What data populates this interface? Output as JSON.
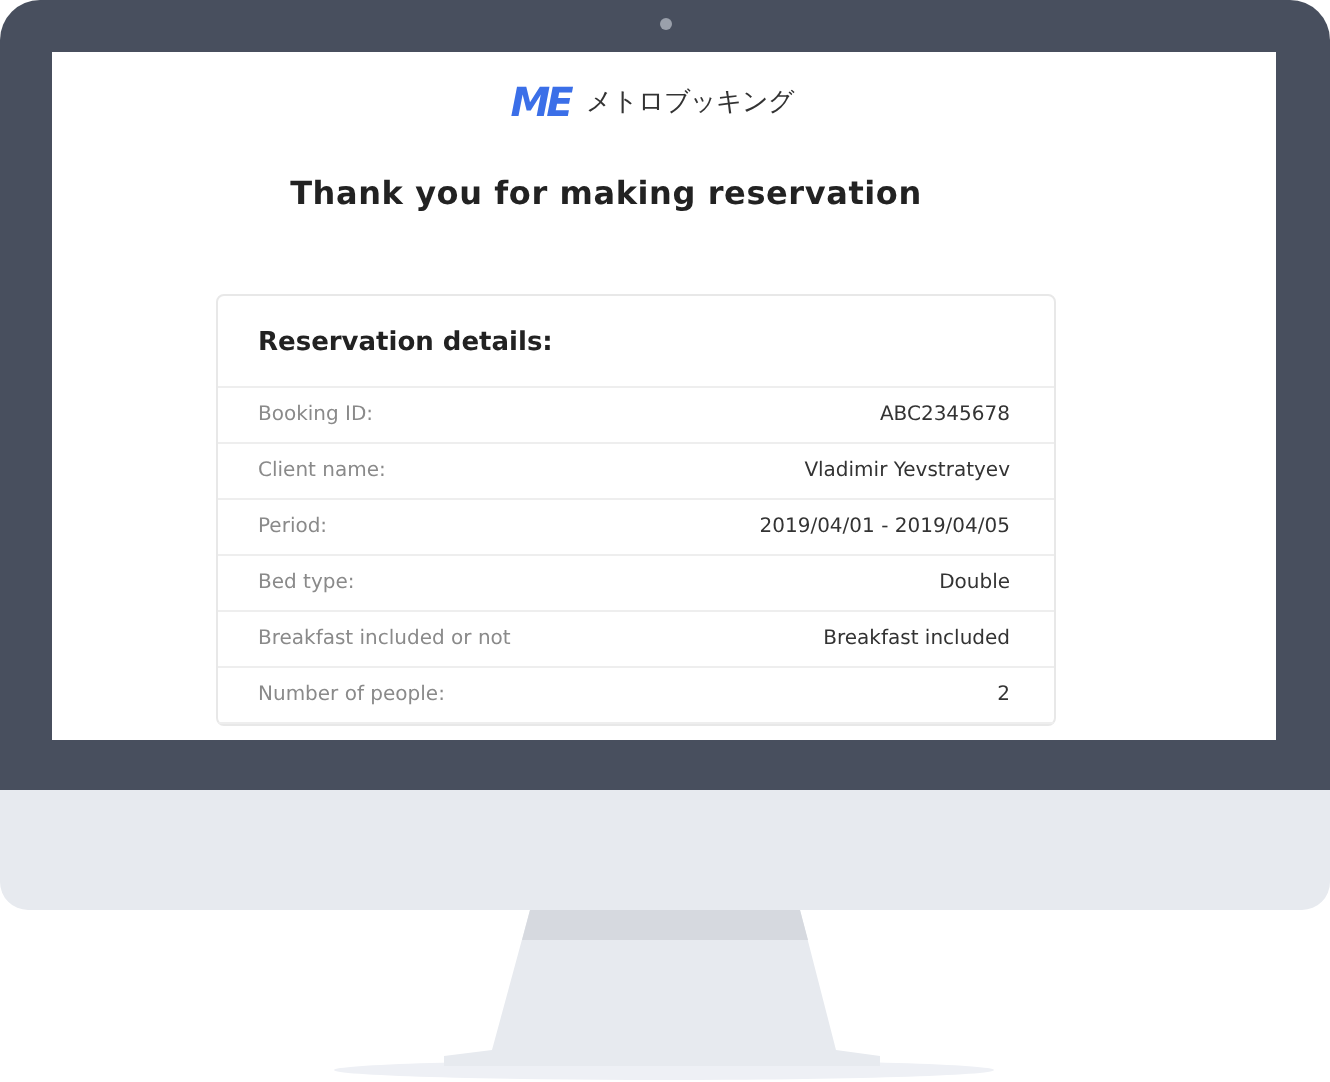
{
  "logo": {
    "mark": "ME",
    "name": "メトロブッキング"
  },
  "title": "Thank you for making reservation",
  "card": {
    "heading": "Reservation details:",
    "rows": [
      {
        "label": "Booking ID:",
        "value": "ABC2345678"
      },
      {
        "label": "Client name:",
        "value": "Vladimir Yevstratyev"
      },
      {
        "label": "Period:",
        "value": "2019/04/01 - 2019/04/05"
      },
      {
        "label": "Bed type:",
        "value": "Double"
      },
      {
        "label": "Breakfast included or not",
        "value": "Breakfast included"
      },
      {
        "label": "Number of people:",
        "value": "2"
      }
    ]
  }
}
